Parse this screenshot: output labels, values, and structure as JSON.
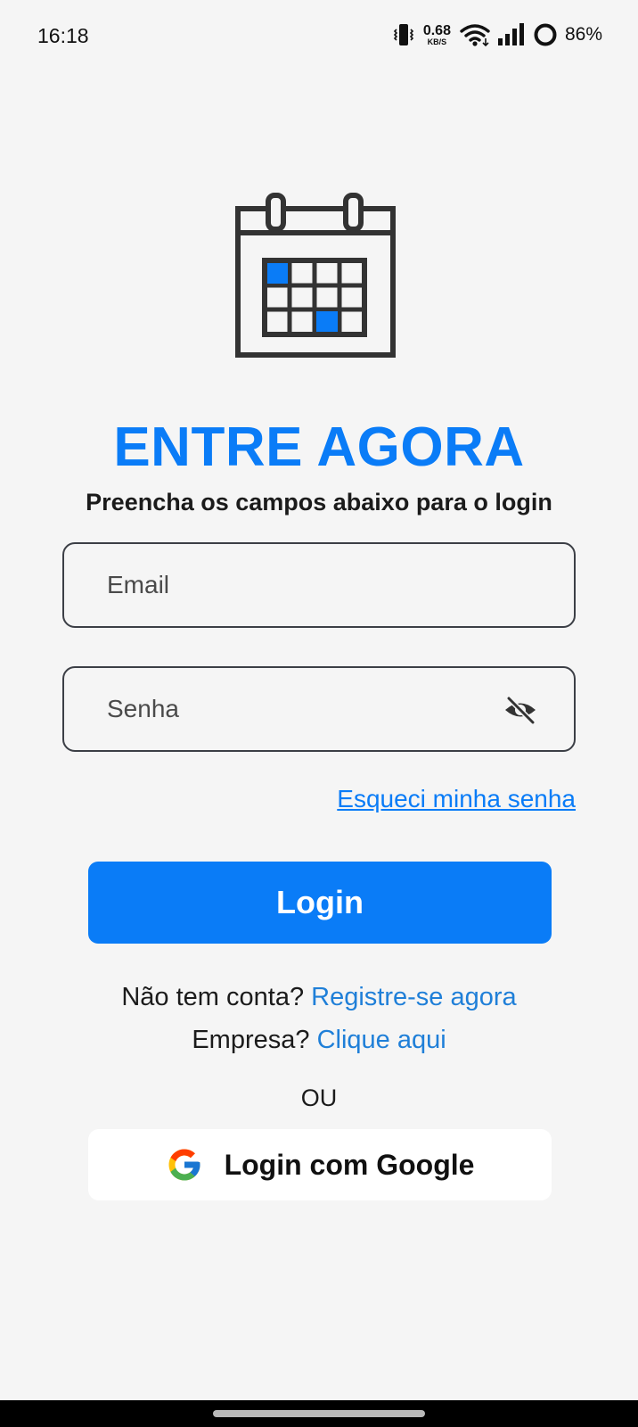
{
  "status_bar": {
    "time": "16:18",
    "net_speed_value": "0.68",
    "net_speed_unit": "KB/S",
    "battery_percent": "86%",
    "icons": [
      "vibrate-icon",
      "wifi-icon",
      "signal-icon",
      "battery-ring-icon"
    ]
  },
  "logo": {
    "icon": "calendar-icon",
    "accent_color": "#0a7cf7"
  },
  "login": {
    "title": "ENTRE AGORA",
    "subtitle": "Preencha os campos abaixo para o login",
    "email_placeholder": "Email",
    "email_value": "",
    "password_placeholder": "Senha",
    "password_value": "",
    "forgot_password": "Esqueci minha senha",
    "login_button": "Login"
  },
  "register": {
    "prompt": "Não tem conta? ",
    "link": "Registre-se agora"
  },
  "company": {
    "prompt": "Empresa? ",
    "link": "Clique aqui"
  },
  "divider_text": "OU",
  "google": {
    "icon": "google-icon",
    "label": "Login com Google"
  },
  "colors": {
    "primary": "#0a7cf7",
    "background": "#f5f5f5",
    "link": "#1f7fd8"
  }
}
